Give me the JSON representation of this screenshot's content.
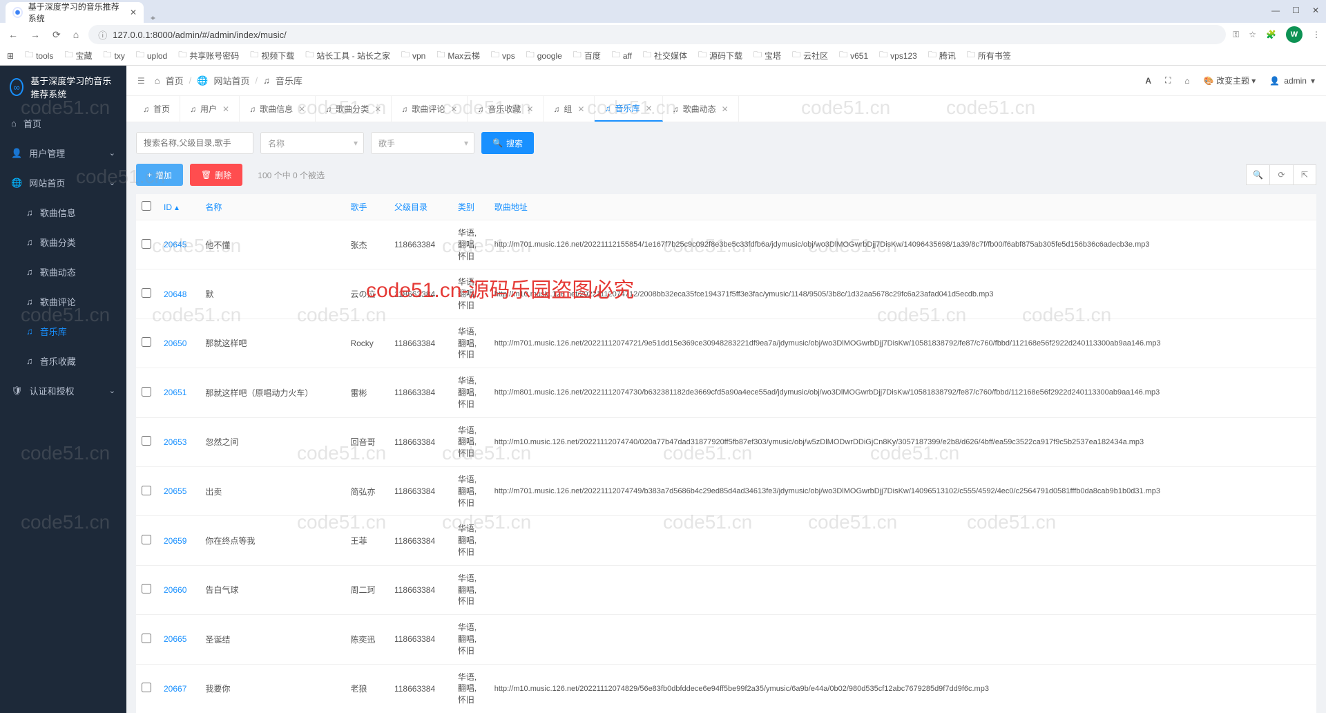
{
  "browser": {
    "tab_title": "基于深度学习的音乐推荐系统",
    "url": "127.0.0.1:8000/admin/#/admin/index/music/",
    "profile_letter": "W",
    "bookmarks": [
      "tools",
      "宝藏",
      "txy",
      "uplod",
      "共享账号密码",
      "视频下载",
      "站长工具 - 站长之家",
      "vpn",
      "Max云梯",
      "vps",
      "google",
      "百度",
      "aff",
      "社交媒体",
      "源码下载",
      "宝塔",
      "云社区",
      "v651",
      "vps123",
      "腾讯"
    ],
    "all_bookmarks": "所有书签"
  },
  "app": {
    "title": "基于深度学习的音乐推荐系统",
    "breadcrumb": {
      "home": "首页",
      "site": "网站首页",
      "music": "音乐库"
    },
    "topbar": {
      "theme": "改变主题",
      "user": "admin"
    },
    "sidebar": [
      {
        "icon": "home",
        "label": "首页",
        "sub": false,
        "active": false,
        "chev": false
      },
      {
        "icon": "user",
        "label": "用户管理",
        "sub": false,
        "active": false,
        "chev": true
      },
      {
        "icon": "globe",
        "label": "网站首页",
        "sub": false,
        "active": false,
        "chev": true
      },
      {
        "icon": "music",
        "label": "歌曲信息",
        "sub": true,
        "active": false,
        "chev": false
      },
      {
        "icon": "music",
        "label": "歌曲分类",
        "sub": true,
        "active": false,
        "chev": false
      },
      {
        "icon": "music",
        "label": "歌曲动态",
        "sub": true,
        "active": false,
        "chev": false
      },
      {
        "icon": "music",
        "label": "歌曲评论",
        "sub": true,
        "active": false,
        "chev": false
      },
      {
        "icon": "music",
        "label": "音乐库",
        "sub": true,
        "active": true,
        "chev": false
      },
      {
        "icon": "music",
        "label": "音乐收藏",
        "sub": true,
        "active": false,
        "chev": false
      },
      {
        "icon": "shield",
        "label": "认证和授权",
        "sub": false,
        "active": false,
        "chev": true
      }
    ],
    "tabs": [
      {
        "label": "首页",
        "active": false,
        "closable": false
      },
      {
        "label": "用户",
        "active": false,
        "closable": true
      },
      {
        "label": "歌曲信息",
        "active": false,
        "closable": true
      },
      {
        "label": "歌曲分类",
        "active": false,
        "closable": true
      },
      {
        "label": "歌曲评论",
        "active": false,
        "closable": true
      },
      {
        "label": "音乐收藏",
        "active": false,
        "closable": true
      },
      {
        "label": "组",
        "active": false,
        "closable": true
      },
      {
        "label": "音乐库",
        "active": true,
        "closable": true
      },
      {
        "label": "歌曲动态",
        "active": false,
        "closable": true
      }
    ],
    "search": {
      "placeholder": "搜索名称,父级目录,歌手",
      "select1": "名称",
      "select2": "歌手",
      "button": "搜索"
    },
    "actions": {
      "add": "增加",
      "delete": "删除",
      "count": "100 个中 0 个被选"
    },
    "columns": [
      "ID",
      "名称",
      "歌手",
      "父级目录",
      "类别",
      "歌曲地址"
    ],
    "rows": [
      {
        "id": "20645",
        "name": "他不懂",
        "singer": "张杰",
        "parent": "118663384",
        "cat": "华语,\n翻唱,\n怀旧",
        "url": "http://m701.music.126.net/20221112155854/1e167f7b25c9c092f8e3be5c33fdfb6a/jdymusic/obj/wo3DlMOGwrbDjj7DisKw/14096435698/1a39/8c7f/fb00/f6abf875ab305fe5d156b36c6adecb3e.mp3"
      },
      {
        "id": "20648",
        "name": "默",
        "singer": "云の泣",
        "parent": "118663384",
        "cat": "华语,\n翻唱,\n怀旧",
        "url": "http://m10.music.126.net/20221112074712/2008bb32eca35fce194371f5ff3e3fac/ymusic/1148/9505/3b8c/1d32aa5678c29fc6a23afad041d5ecdb.mp3"
      },
      {
        "id": "20650",
        "name": "那就这样吧",
        "singer": "Rocky",
        "parent": "118663384",
        "cat": "华语,\n翻唱,\n怀旧",
        "url": "http://m701.music.126.net/20221112074721/9e51dd15e369ce30948283221df9ea7a/jdymusic/obj/wo3DlMOGwrbDjj7DisKw/10581838792/fe87/c760/fbbd/112168e56f2922d240113300ab9aa146.mp3"
      },
      {
        "id": "20651",
        "name": "那就这样吧（原唱动力火车）",
        "singer": "雷彬",
        "parent": "118663384",
        "cat": "华语,\n翻唱,\n怀旧",
        "url": "http://m801.music.126.net/20221112074730/b632381182de3669cfd5a90a4ece55ad/jdymusic/obj/wo3DlMOGwrbDjj7DisKw/10581838792/fe87/c760/fbbd/112168e56f2922d240113300ab9aa146.mp3"
      },
      {
        "id": "20653",
        "name": "忽然之间",
        "singer": "回音哥",
        "parent": "118663384",
        "cat": "华语,\n翻唱,\n怀旧",
        "url": "http://m10.music.126.net/20221112074740/020a77b47dad31877920ff5fb87ef303/ymusic/obj/w5zDlMODwrDDiGjCn8Ky/3057187399/e2b8/d626/4bff/ea59c3522ca917f9c5b2537ea182434a.mp3"
      },
      {
        "id": "20655",
        "name": "出卖",
        "singer": "简弘亦",
        "parent": "118663384",
        "cat": "华语,\n翻唱,\n怀旧",
        "url": "http://m701.music.126.net/20221112074749/b383a7d5686b4c29ed85d4ad34613fe3/jdymusic/obj/wo3DlMOGwrbDjj7DisKw/14096513102/c555/4592/4ec0/c2564791d0581fffb0da8cab9b1b0d31.mp3"
      },
      {
        "id": "20659",
        "name": "你在终点等我",
        "singer": "王菲",
        "parent": "118663384",
        "cat": "华语,\n翻唱,\n怀旧",
        "url": ""
      },
      {
        "id": "20660",
        "name": "告白气球",
        "singer": "周二珂",
        "parent": "118663384",
        "cat": "华语,\n翻唱,\n怀旧",
        "url": ""
      },
      {
        "id": "20665",
        "name": "圣诞结",
        "singer": "陈奕迅",
        "parent": "118663384",
        "cat": "华语,\n翻唱,\n怀旧",
        "url": ""
      },
      {
        "id": "20667",
        "name": "我要你",
        "singer": "老狼",
        "parent": "118663384",
        "cat": "华语,\n翻唱,\n怀旧",
        "url": "http://m10.music.126.net/20221112074829/56e83fb0dbfddece6e94ff5be99f2a35/ymusic/6a9b/e44a/0b02/980d535cf12abc7679285d9f7dd9f6c.mp3"
      }
    ]
  },
  "watermark": "code51.cn",
  "watermark_red": "code51.cn-源码乐园盗图必究"
}
